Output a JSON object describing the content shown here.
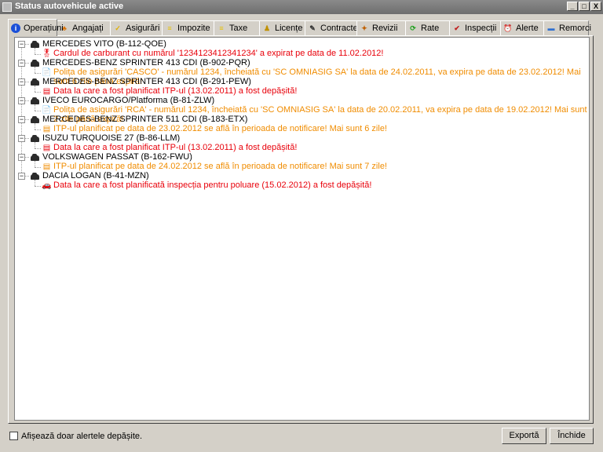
{
  "window": {
    "title": "Status autovehicule active",
    "minimize": "_",
    "maximize": "□",
    "close": "X"
  },
  "tabs": [
    {
      "label": "Operațiuni",
      "icon": "info-icon",
      "color": "#1a4fd8"
    },
    {
      "label": "Angajați",
      "icon": "people-icon",
      "color": "#d8740a"
    },
    {
      "label": "Asigurări",
      "icon": "insurance-icon",
      "color": "#e0b000"
    },
    {
      "label": "Impozite",
      "icon": "tax-money-icon",
      "color": "#e8c000"
    },
    {
      "label": "Taxe",
      "icon": "fees-icon",
      "color": "#e8c000"
    },
    {
      "label": "Licențe",
      "icon": "license-person-icon",
      "color": "#c09000"
    },
    {
      "label": "Contracte",
      "icon": "contract-icon",
      "color": "#303030"
    },
    {
      "label": "Revizii",
      "icon": "service-icon",
      "color": "#c06000"
    },
    {
      "label": "Rate",
      "icon": "installments-icon",
      "color": "#20a020"
    },
    {
      "label": "Inspecții",
      "icon": "inspection-icon",
      "color": "#c02020"
    },
    {
      "label": "Alerte",
      "icon": "alarm-icon",
      "color": "#d83000"
    },
    {
      "label": "Remorci",
      "icon": "trailer-icon",
      "color": "#3070d0"
    }
  ],
  "tree": [
    {
      "vehicle": "MERCEDES VITO (B-112-QOE)",
      "alert_icon": "fuel-card-icon",
      "alert_color": "red",
      "message": "Cardul de carburant cu numărul '1234123412341234' a expirat pe data de 11.02.2012!"
    },
    {
      "vehicle": "MERCEDES-BENZ SPRINTER 413 CDI (B-902-PQR)",
      "alert_icon": "insurance-document-icon",
      "alert_color": "orange",
      "message": "Polița de asigurări 'CASCO' - numărul 1234, încheiată cu 'SC OMNIASIG SA' la data de 24.02.2011,  va expira pe data de 23.02.2012! Mai sunt 6 zile până expiră!"
    },
    {
      "vehicle": "MERCEDES-BENZ SPRINTER 413 CDI (B-291-PEW)",
      "alert_icon": "itp-inspection-icon",
      "alert_color": "red",
      "message": "Data la care a fost planificat ITP-ul (13.02.2011) a fost depășită!"
    },
    {
      "vehicle": "IVECO EUROCARGO/Platforma (B-81-ZLW)",
      "alert_icon": "insurance-document-icon",
      "alert_color": "orange",
      "message": "Polița de asigurări 'RCA' - numărul 1234, încheiată cu 'SC OMNIASIG SA' la data de 20.02.2011,  va expira pe data de 19.02.2012! Mai sunt 2 zile până expiră!"
    },
    {
      "vehicle": "MERCEDES-BENZ SPRINTER 511 CDI (B-183-ETX)",
      "alert_icon": "itp-inspection-icon",
      "alert_color": "orange",
      "message": "ITP-ul planificat pe data de 23.02.2012 se află în perioada de notificare! Mai sunt 6 zile!"
    },
    {
      "vehicle": "ISUZU TURQUOISE 27 (B-86-LLM)",
      "alert_icon": "itp-inspection-icon",
      "alert_color": "red",
      "message": "Data la care a fost planificat ITP-ul (13.02.2011) a fost depășită!"
    },
    {
      "vehicle": "VOLKSWAGEN PASSAT (B-162-FWU)",
      "alert_icon": "itp-inspection-icon",
      "alert_color": "orange",
      "message": "ITP-ul planificat pe data de 24.02.2012 se află în perioada de notificare! Mai sunt 7 zile!"
    },
    {
      "vehicle": "DACIA LOGAN (B-41-MZN)",
      "alert_icon": "pollution-car-icon",
      "alert_color": "red",
      "message": "Data la care a fost planificată inspecția pentru poluare (15.02.2012) a fost depășită!"
    }
  ],
  "footer": {
    "checkbox_label": "Afișează doar alertele depășite.",
    "checkbox_checked": false,
    "export_button": "Exportă",
    "close_button": "Închide"
  },
  "colors": {
    "alert_red": "#e8000a",
    "alert_orange": "#f08c00",
    "titlebar": "#7a7a7a"
  }
}
